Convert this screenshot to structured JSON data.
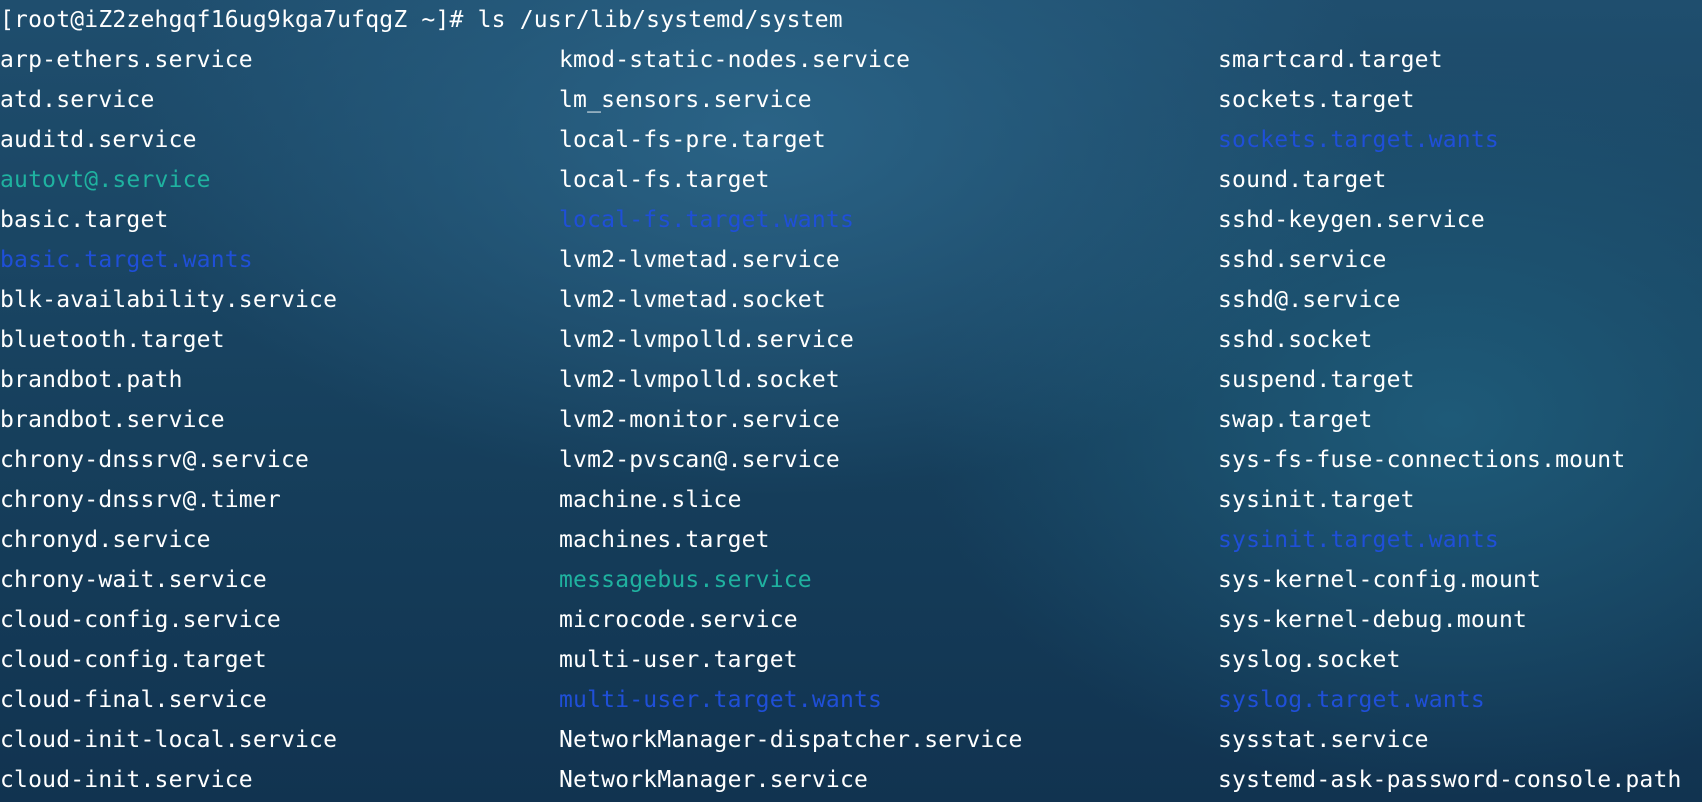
{
  "terminal": {
    "prompt": "[root@iZ2zehgqf16ug9kga7ufqgZ ~]# ls /usr/lib/systemd/system"
  },
  "colors": {
    "regular": "#ffffff",
    "directory": "#1f4fd8",
    "symlink": "#1fb2a0"
  },
  "listing": {
    "columns": [
      [
        {
          "name": "arp-ethers.service",
          "kind": "regular"
        },
        {
          "name": "atd.service",
          "kind": "regular"
        },
        {
          "name": "auditd.service",
          "kind": "regular"
        },
        {
          "name": "autovt@.service",
          "kind": "symlink"
        },
        {
          "name": "basic.target",
          "kind": "regular"
        },
        {
          "name": "basic.target.wants",
          "kind": "directory"
        },
        {
          "name": "blk-availability.service",
          "kind": "regular"
        },
        {
          "name": "bluetooth.target",
          "kind": "regular"
        },
        {
          "name": "brandbot.path",
          "kind": "regular"
        },
        {
          "name": "brandbot.service",
          "kind": "regular"
        },
        {
          "name": "chrony-dnssrv@.service",
          "kind": "regular"
        },
        {
          "name": "chrony-dnssrv@.timer",
          "kind": "regular"
        },
        {
          "name": "chronyd.service",
          "kind": "regular"
        },
        {
          "name": "chrony-wait.service",
          "kind": "regular"
        },
        {
          "name": "cloud-config.service",
          "kind": "regular"
        },
        {
          "name": "cloud-config.target",
          "kind": "regular"
        },
        {
          "name": "cloud-final.service",
          "kind": "regular"
        },
        {
          "name": "cloud-init-local.service",
          "kind": "regular"
        },
        {
          "name": "cloud-init.service",
          "kind": "regular"
        }
      ],
      [
        {
          "name": "kmod-static-nodes.service",
          "kind": "regular"
        },
        {
          "name": "lm_sensors.service",
          "kind": "regular"
        },
        {
          "name": "local-fs-pre.target",
          "kind": "regular"
        },
        {
          "name": "local-fs.target",
          "kind": "regular"
        },
        {
          "name": "local-fs.target.wants",
          "kind": "directory"
        },
        {
          "name": "lvm2-lvmetad.service",
          "kind": "regular"
        },
        {
          "name": "lvm2-lvmetad.socket",
          "kind": "regular"
        },
        {
          "name": "lvm2-lvmpolld.service",
          "kind": "regular"
        },
        {
          "name": "lvm2-lvmpolld.socket",
          "kind": "regular"
        },
        {
          "name": "lvm2-monitor.service",
          "kind": "regular"
        },
        {
          "name": "lvm2-pvscan@.service",
          "kind": "regular"
        },
        {
          "name": "machine.slice",
          "kind": "regular"
        },
        {
          "name": "machines.target",
          "kind": "regular"
        },
        {
          "name": "messagebus.service",
          "kind": "symlink"
        },
        {
          "name": "microcode.service",
          "kind": "regular"
        },
        {
          "name": "multi-user.target",
          "kind": "regular"
        },
        {
          "name": "multi-user.target.wants",
          "kind": "directory"
        },
        {
          "name": "NetworkManager-dispatcher.service",
          "kind": "regular"
        },
        {
          "name": "NetworkManager.service",
          "kind": "regular"
        }
      ],
      [
        {
          "name": "smartcard.target",
          "kind": "regular"
        },
        {
          "name": "sockets.target",
          "kind": "regular"
        },
        {
          "name": "sockets.target.wants",
          "kind": "directory"
        },
        {
          "name": "sound.target",
          "kind": "regular"
        },
        {
          "name": "sshd-keygen.service",
          "kind": "regular"
        },
        {
          "name": "sshd.service",
          "kind": "regular"
        },
        {
          "name": "sshd@.service",
          "kind": "regular"
        },
        {
          "name": "sshd.socket",
          "kind": "regular"
        },
        {
          "name": "suspend.target",
          "kind": "regular"
        },
        {
          "name": "swap.target",
          "kind": "regular"
        },
        {
          "name": "sys-fs-fuse-connections.mount",
          "kind": "regular"
        },
        {
          "name": "sysinit.target",
          "kind": "regular"
        },
        {
          "name": "sysinit.target.wants",
          "kind": "directory"
        },
        {
          "name": "sys-kernel-config.mount",
          "kind": "regular"
        },
        {
          "name": "sys-kernel-debug.mount",
          "kind": "regular"
        },
        {
          "name": "syslog.socket",
          "kind": "regular"
        },
        {
          "name": "syslog.target.wants",
          "kind": "directory"
        },
        {
          "name": "sysstat.service",
          "kind": "regular"
        },
        {
          "name": "systemd-ask-password-console.path",
          "kind": "regular"
        }
      ]
    ]
  }
}
